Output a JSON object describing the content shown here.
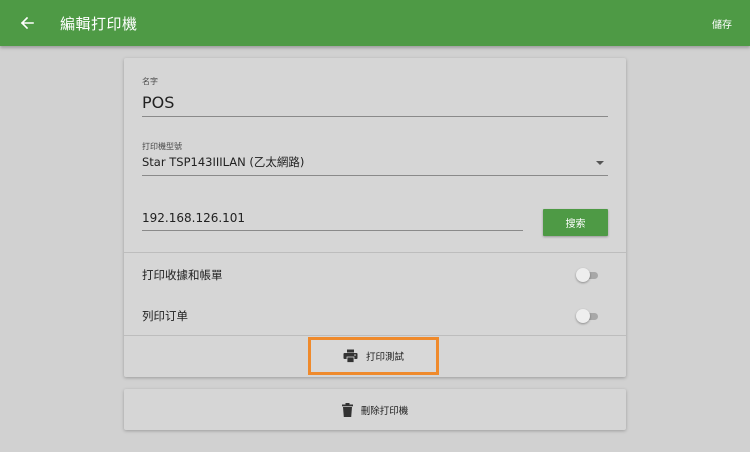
{
  "appbar": {
    "title": "編輯打印機",
    "save_label": "儲存",
    "color": "#4e9a45"
  },
  "form": {
    "name": {
      "label": "名字",
      "value": "POS"
    },
    "model": {
      "label": "打印機型號",
      "value": "Star TSP143IIILAN (乙太網路)"
    },
    "ip": {
      "value": "192.168.126.101"
    },
    "search_label": "搜索",
    "toggles": [
      {
        "label": "打印收據和帳單",
        "on": false
      },
      {
        "label": "列印订单",
        "on": false
      }
    ],
    "test_print_label": "打印測試"
  },
  "delete_label": "刪除打印機",
  "icons": {
    "back": "arrow-left-icon",
    "print": "printer-icon",
    "delete": "trash-icon"
  },
  "colors": {
    "accent": "#4e9a45",
    "highlight": "#ef8a2c"
  }
}
